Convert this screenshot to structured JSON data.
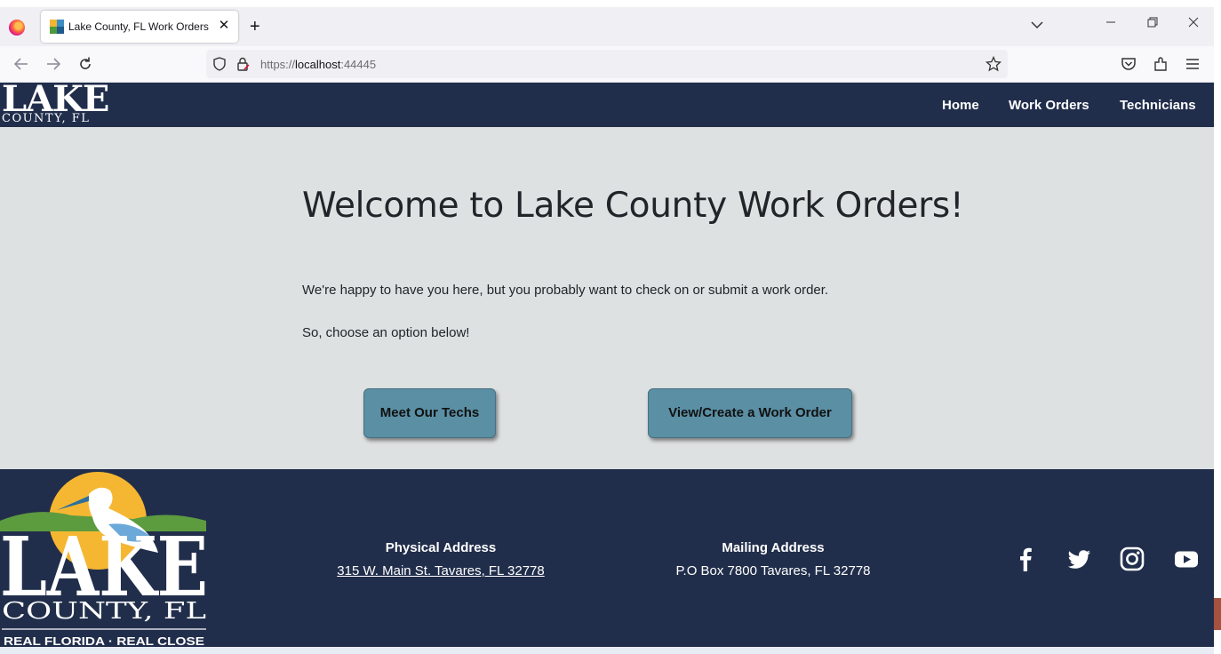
{
  "browser": {
    "tab_title": "Lake County, FL Work Orders",
    "tab_close": "✕",
    "new_tab": "+",
    "url_prefix": "https://",
    "url_host": "localhost",
    "url_port": ":44445",
    "icons": [
      "firefox-icon",
      "back-icon",
      "forward-icon",
      "reload-icon",
      "shield-icon",
      "lock-icon",
      "star-icon",
      "pocket-icon",
      "extensions-icon",
      "menu-icon",
      "tab-list-icon",
      "minimize-icon",
      "restore-icon",
      "close-window-icon"
    ]
  },
  "header": {
    "logo_big": "LAKE",
    "logo_small": "COUNTY, FL",
    "nav": {
      "home": "Home",
      "work_orders": "Work Orders",
      "technicians": "Technicians"
    }
  },
  "main": {
    "heading": "Welcome to Lake County Work Orders!",
    "para1": "We're happy to have you here, but you probably want to check on or submit a work order.",
    "para2": "So, choose an option below!",
    "btn_techs": "Meet Our Techs",
    "btn_orders": "View/Create a Work Order"
  },
  "footer": {
    "logo_big": "LAKE",
    "logo_county": "COUNTY, FL",
    "logo_tagline": "REAL FLORIDA · REAL CLOSE",
    "physical_title": "Physical Address",
    "physical_text": "315 W. Main St. Tavares, FL 32778",
    "mailing_title": "Mailing Address",
    "mailing_text": "P.O Box 7800 Tavares, FL 32778",
    "social": [
      "facebook-icon",
      "twitter-icon",
      "instagram-icon",
      "youtube-icon"
    ]
  },
  "colors": {
    "header_bg": "#212e4b",
    "main_bg": "#dee1e2",
    "button_bg": "#5a8fa4",
    "footer_bg": "#212e4b"
  }
}
